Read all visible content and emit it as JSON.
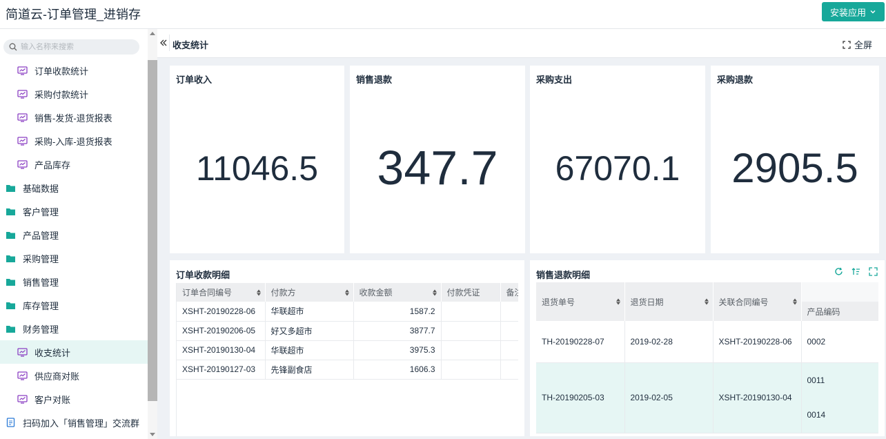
{
  "app": {
    "title": "简道云-订单管理_进销存",
    "install_label": "安装应用"
  },
  "sidebar": {
    "search_placeholder": "输入名称来搜索",
    "items": [
      {
        "label": "订单收款统计",
        "type": "report"
      },
      {
        "label": "采购付款统计",
        "type": "report"
      },
      {
        "label": "销售-发货-退货报表",
        "type": "report"
      },
      {
        "label": "采购-入库-退货报表",
        "type": "report"
      },
      {
        "label": "产品库存",
        "type": "report"
      },
      {
        "label": "基础数据",
        "type": "folder"
      },
      {
        "label": "客户管理",
        "type": "folder"
      },
      {
        "label": "产品管理",
        "type": "folder"
      },
      {
        "label": "采购管理",
        "type": "folder"
      },
      {
        "label": "销售管理",
        "type": "folder"
      },
      {
        "label": "库存管理",
        "type": "folder"
      },
      {
        "label": "财务管理",
        "type": "folder"
      },
      {
        "label": "收支统计",
        "type": "report",
        "active": true
      },
      {
        "label": "供应商对账",
        "type": "report"
      },
      {
        "label": "客户对账",
        "type": "report"
      },
      {
        "label": "扫码加入「销售管理」交流群",
        "type": "doc"
      }
    ]
  },
  "header": {
    "title": "收支统计",
    "fullscreen_label": "全屏"
  },
  "stats": [
    {
      "title": "订单收入",
      "value": "11046.5"
    },
    {
      "title": "销售退款",
      "value": "347.7"
    },
    {
      "title": "采购支出",
      "value": "67070.1"
    },
    {
      "title": "采购退款",
      "value": "2905.5"
    }
  ],
  "order_receipts": {
    "title": "订单收款明细",
    "columns": [
      "订单合同编号",
      "付款方",
      "收款金额",
      "付款凭证",
      "备注"
    ],
    "rows": [
      [
        "XSHT-20190228-06",
        "华联超市",
        "1587.2",
        "",
        ""
      ],
      [
        "XSHT-20190206-05",
        "好又多超市",
        "3877.7",
        "",
        ""
      ],
      [
        "XSHT-20190130-04",
        "华联超市",
        "3975.3",
        "",
        ""
      ],
      [
        "XSHT-20190127-03",
        "先锋副食店",
        "1606.3",
        "",
        ""
      ]
    ]
  },
  "sales_refunds": {
    "title": "销售退款明细",
    "columns": [
      "退货单号",
      "退货日期",
      "关联合同编号",
      "产品编码"
    ],
    "rows": [
      {
        "no": "TH-20190228-07",
        "date": "2019-02-28",
        "contract": "XSHT-20190228-06",
        "codes": [
          "0002"
        ]
      },
      {
        "no": "TH-20190205-03",
        "date": "2019-02-05",
        "contract": "XSHT-20190130-04",
        "codes": [
          "0011",
          "0014"
        ]
      }
    ]
  },
  "colors": {
    "accent": "#17a89a",
    "report_icon": "#8a3fc2",
    "folder_icon": "#17a89a"
  }
}
